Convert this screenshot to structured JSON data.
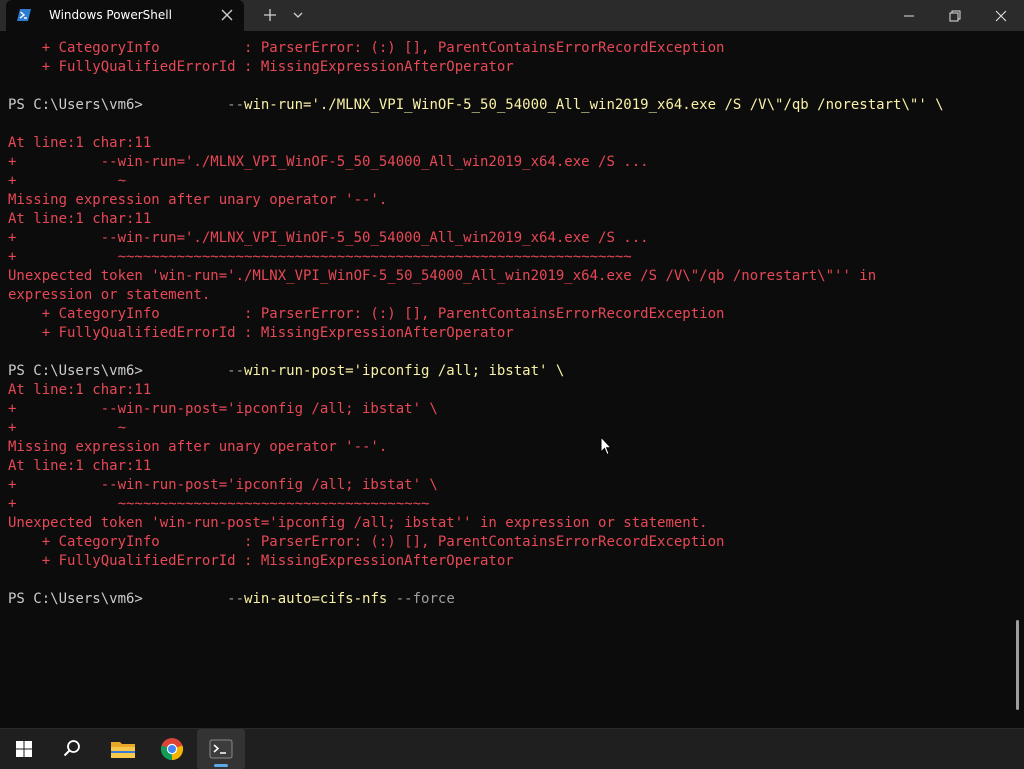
{
  "window": {
    "tab_title": "Windows PowerShell",
    "icons": {
      "tab": "powershell-icon",
      "close": "close-icon",
      "new_tab": "plus-icon",
      "dropdown": "chevron-down-icon",
      "minimize": "minimize-icon",
      "maximize": "restore-icon",
      "close_window": "close-icon"
    }
  },
  "console": {
    "prompt": "PS C:\\Users\\vm6> ",
    "lines": [
      "    + CategoryInfo          : ParserError: (:) [], ParentContainsErrorRecordException",
      "    + FullyQualifiedErrorId : MissingExpressionAfterOperator",
      "",
      "",
      "",
      "At line:1 char:11",
      "+          --win-run='./MLNX_VPI_WinOF-5_50_54000_All_win2019_x64.exe /S ...",
      "+            ~",
      "Missing expression after unary operator '--'.",
      "At line:1 char:11",
      "+          --win-run='./MLNX_VPI_WinOF-5_50_54000_All_win2019_x64.exe /S ...",
      "+            ~~~~~~~~~~~~~~~~~~~~~~~~~~~~~~~~~~~~~~~~~~~~~~~~~~~~~~~~~~~~~",
      "Unexpected token 'win-run='./MLNX_VPI_WinOF-5_50_54000_All_win2019_x64.exe /S /V\\\"/qb /norestart\\\"'' in",
      "expression or statement.",
      "    + CategoryInfo          : ParserError: (:) [], ParentContainsErrorRecordException",
      "    + FullyQualifiedErrorId : MissingExpressionAfterOperator",
      "",
      "",
      "At line:1 char:11",
      "+          --win-run-post='ipconfig /all; ibstat' \\",
      "+            ~",
      "Missing expression after unary operator '--'.",
      "At line:1 char:11",
      "+          --win-run-post='ipconfig /all; ibstat' \\",
      "+            ~~~~~~~~~~~~~~~~~~~~~~~~~~~~~~~~~~~~~",
      "Unexpected token 'win-run-post='ipconfig /all; ibstat'' in expression or statement.",
      "    + CategoryInfo          : ParserError: (:) [], ParentContainsErrorRecordException",
      "    + FullyQualifiedErrorId : MissingExpressionAfterOperator"
    ],
    "commands": [
      {
        "indent": "         ",
        "dashes": "--",
        "text": "win-run='./MLNX_VPI_WinOF-5_50_54000_All_win2019_x64.exe /S /V\\\"/qb /norestart\\\"' \\"
      },
      {
        "indent": "         ",
        "dashes": "--",
        "text": "win-run-post='ipconfig /all; ibstat' \\"
      },
      {
        "indent": "         ",
        "dashes": "--",
        "text": "win-auto=cifs-nfs",
        "extra": " --force"
      }
    ]
  },
  "taskbar": {
    "items": [
      "windows-start-icon",
      "search-icon",
      "file-explorer-icon",
      "chrome-icon",
      "terminal-icon"
    ]
  }
}
